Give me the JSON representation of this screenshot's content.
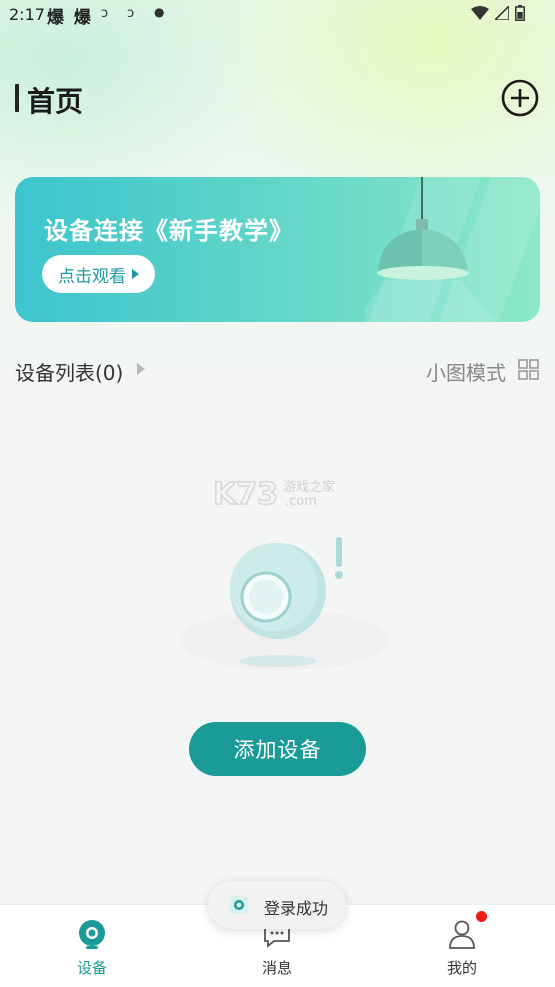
{
  "status_bar": {
    "time": "2:17",
    "notification_glyphs": "爆 爆",
    "sync_glyph": "ↄ"
  },
  "header": {
    "title": "首页"
  },
  "banner": {
    "title": "设备连接《新手教学》",
    "button_label": "点击观看"
  },
  "device_list": {
    "title": "设备列表(0)",
    "mode_label": "小图模式"
  },
  "watermark": {
    "brand": "K73",
    "sub": "游戏之家",
    "domain": ".com"
  },
  "empty_state": {
    "add_button_label": "添加设备"
  },
  "toast": {
    "text": "登录成功"
  },
  "bottom_nav": {
    "items": [
      {
        "label": "设备",
        "icon": "camera-icon",
        "active": true
      },
      {
        "label": "消息",
        "icon": "message-icon",
        "active": false
      },
      {
        "label": "我的",
        "icon": "profile-icon",
        "active": false,
        "badge": true
      }
    ]
  },
  "colors": {
    "accent": "#1a9b97",
    "banner_start": "#3cc4cd",
    "banner_end": "#8ce8c8",
    "badge": "#f41a1a"
  }
}
